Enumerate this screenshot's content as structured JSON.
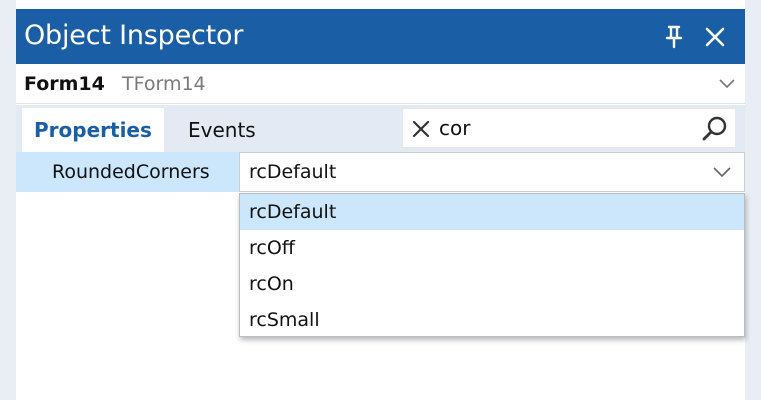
{
  "window": {
    "title": "Object Inspector",
    "pin_icon": "pin-icon",
    "close_icon": "close-icon",
    "accent_color": "#1a5ea6"
  },
  "object_selector": {
    "name": "Form14",
    "type": "TForm14",
    "chevron_icon": "chevron-down-icon"
  },
  "tabs": [
    {
      "label": "Properties",
      "active": true
    },
    {
      "label": "Events",
      "active": false
    }
  ],
  "search": {
    "value": "cor",
    "clear_icon": "close-icon",
    "search_icon": "search-icon"
  },
  "property": {
    "name": "RoundedCorners",
    "value": "rcDefault",
    "highlight_color": "#cce6fb"
  },
  "dropdown": {
    "options": [
      {
        "label": "rcDefault",
        "selected": true
      },
      {
        "label": "rcOff",
        "selected": false
      },
      {
        "label": "rcOn",
        "selected": false
      },
      {
        "label": "rcSmall",
        "selected": false
      }
    ]
  }
}
